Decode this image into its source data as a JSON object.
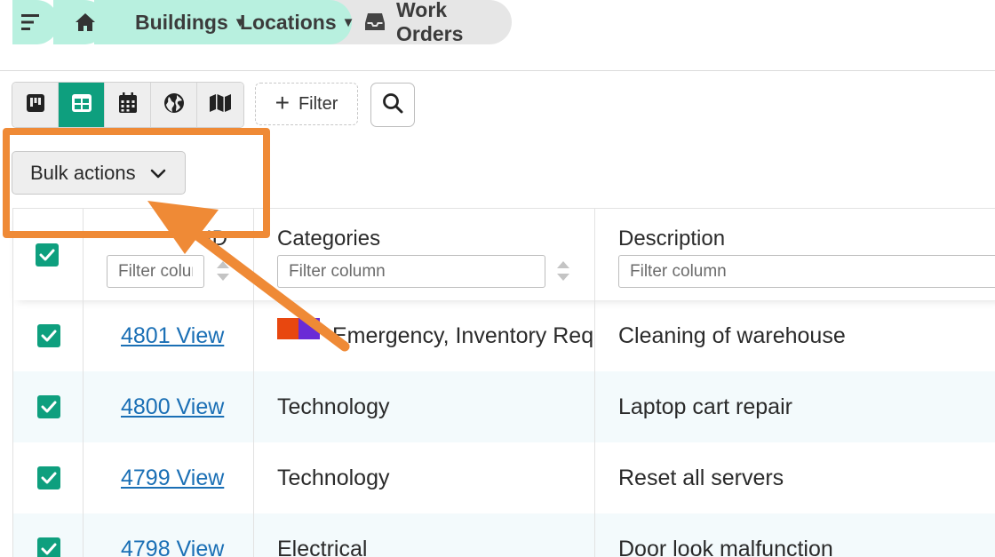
{
  "breadcrumb": {
    "menu_icon": "hamburger-menu-icon",
    "home_icon": "home-icon",
    "buildings": "Buildings",
    "locations": "Locations",
    "current_icon": "inbox-tray-icon",
    "current": "Work Orders"
  },
  "toolbar": {
    "views": [
      {
        "icon": "kanban-board-icon",
        "active": false
      },
      {
        "icon": "table-grid-icon",
        "active": true
      },
      {
        "icon": "calendar-icon",
        "active": false
      },
      {
        "icon": "globe-icon",
        "active": false
      },
      {
        "icon": "map-icon",
        "active": false
      }
    ],
    "filter_label": "Filter",
    "search_icon": "search-icon"
  },
  "bulk_actions": {
    "label": "Bulk actions"
  },
  "table": {
    "columns": {
      "id": "ID",
      "categories": "Categories",
      "description": "Description"
    },
    "filter_placeholder": "Filter column",
    "rows": [
      {
        "id_link": "4801 View",
        "categories": "Emergency, Inventory Req",
        "description": "Cleaning of warehouse",
        "checked": true
      },
      {
        "id_link": "4800 View",
        "categories": "Technology",
        "description": "Laptop cart repair",
        "checked": true
      },
      {
        "id_link": "4799 View",
        "categories": "Technology",
        "description": "Reset all servers",
        "checked": true
      },
      {
        "id_link": "4798 View",
        "categories": "Electrical",
        "description": "Door look malfunction",
        "checked": true
      }
    ]
  },
  "colors": {
    "accent": "#0e9f7e",
    "breadcrumb_bg": "#b8f0df",
    "link": "#1a6fb5",
    "annotation": "#ef8a36",
    "category_swatch_1": "#e8470f",
    "category_swatch_2": "#6a2bd6"
  }
}
